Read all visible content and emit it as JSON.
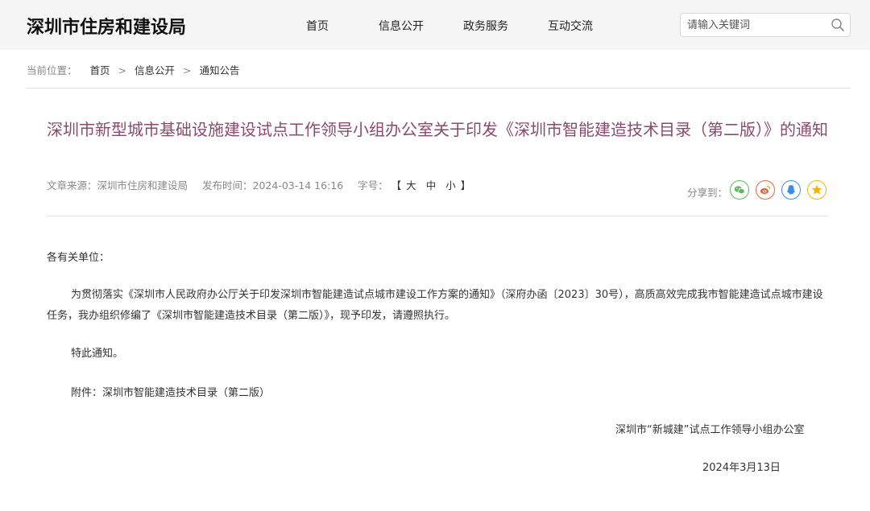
{
  "header": {
    "logo": "深圳市住房和建设局",
    "nav": [
      "首页",
      "信息公开",
      "政务服务",
      "互动交流"
    ],
    "search_placeholder": "请输入关键词"
  },
  "breadcrumb": {
    "lead": "当前位置：",
    "items": [
      "首页",
      "信息公开",
      "通知公告"
    ],
    "separator": ">"
  },
  "article": {
    "title": "深圳市新型城市基础设施建设试点工作领导小组办公室关于印发《深圳市智能建造技术目录（第二版）》的通知",
    "meta": {
      "source": "文章来源：深圳市住房和建设局",
      "time": "发布时间：2024-03-14 16:16",
      "fontsize_label": "字号：",
      "fontsize_open": "【",
      "fontsize_options": [
        "大",
        "中",
        "小"
      ],
      "fontsize_close": "】"
    },
    "share": {
      "label": "分享到：",
      "buttons": [
        {
          "icon": "wechat-icon",
          "color": "#5cb85c"
        },
        {
          "icon": "weibo-icon",
          "color": "#e8643c"
        },
        {
          "icon": "qq-icon",
          "color": "#3a8ee6"
        },
        {
          "icon": "qzone-star-icon",
          "color": "#f0b400"
        }
      ]
    },
    "salutation": "各有关单位：",
    "body": "为贯彻落实《深圳市人民政府办公厅关于印发深圳市智能建造试点城市建设工作方案的通知》（深府办函〔2023〕30号），高质高效完成我市智能建造试点城市建设任务，我办组织修编了《深圳市智能建造技术目录（第二版）》，现予印发，请遵照执行。",
    "special_notice": "特此通知。",
    "attachment": "附件：深圳市智能建造技术目录（第二版）",
    "signature": "深圳市“新城建”试点工作领导小组办公室",
    "date": "2024年3月13日"
  }
}
